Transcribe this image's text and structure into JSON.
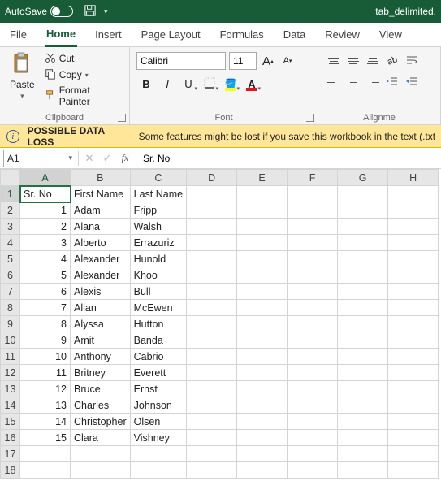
{
  "titlebar": {
    "autosave_label": "AutoSave",
    "autosave_off": "Off",
    "filename": "tab_delimited."
  },
  "tabs": {
    "file": "File",
    "home": "Home",
    "insert": "Insert",
    "page_layout": "Page Layout",
    "formulas": "Formulas",
    "data": "Data",
    "review": "Review",
    "view": "View"
  },
  "ribbon": {
    "clipboard": {
      "label": "Clipboard",
      "paste": "Paste",
      "cut": "Cut",
      "copy": "Copy",
      "format_painter": "Format Painter"
    },
    "font": {
      "label": "Font",
      "name": "Calibri",
      "size": "11",
      "bold": "B",
      "italic": "I",
      "underline": "U",
      "fill_letter": "A",
      "fontcolor_letter": "A",
      "grow": "A",
      "shrink": "A"
    },
    "alignment": {
      "label": "Alignme"
    }
  },
  "msgbar": {
    "title": "POSSIBLE DATA LOSS",
    "text": "Some features might be lost if you save this workbook in the text (.txt) f"
  },
  "fbar": {
    "namebox": "A1",
    "fx": "fx",
    "value": "Sr. No"
  },
  "cols": [
    "A",
    "B",
    "C",
    "D",
    "E",
    "F",
    "G",
    "H"
  ],
  "active": {
    "col": 0,
    "row": 0
  },
  "rows_shown": 18,
  "cells": [
    [
      "Sr. No",
      "First Name",
      "Last Name",
      "",
      "",
      "",
      "",
      ""
    ],
    [
      "1",
      "Adam",
      "Fripp",
      "",
      "",
      "",
      "",
      ""
    ],
    [
      "2",
      "Alana",
      "Walsh",
      "",
      "",
      "",
      "",
      ""
    ],
    [
      "3",
      "Alberto",
      "Errazuriz",
      "",
      "",
      "",
      "",
      ""
    ],
    [
      "4",
      "Alexander",
      "Hunold",
      "",
      "",
      "",
      "",
      ""
    ],
    [
      "5",
      "Alexander",
      "Khoo",
      "",
      "",
      "",
      "",
      ""
    ],
    [
      "6",
      "Alexis",
      "Bull",
      "",
      "",
      "",
      "",
      ""
    ],
    [
      "7",
      "Allan",
      "McEwen",
      "",
      "",
      "",
      "",
      ""
    ],
    [
      "8",
      "Alyssa",
      "Hutton",
      "",
      "",
      "",
      "",
      ""
    ],
    [
      "9",
      "Amit",
      "Banda",
      "",
      "",
      "",
      "",
      ""
    ],
    [
      "10",
      "Anthony",
      "Cabrio",
      "",
      "",
      "",
      "",
      ""
    ],
    [
      "11",
      "Britney",
      "Everett",
      "",
      "",
      "",
      "",
      ""
    ],
    [
      "12",
      "Bruce",
      "Ernst",
      "",
      "",
      "",
      "",
      ""
    ],
    [
      "13",
      "Charles",
      "Johnson",
      "",
      "",
      "",
      "",
      ""
    ],
    [
      "14",
      "Christopher",
      "Olsen",
      "",
      "",
      "",
      "",
      ""
    ],
    [
      "15",
      "Clara",
      "Vishney",
      "",
      "",
      "",
      "",
      ""
    ],
    [
      "",
      "",
      "",
      "",
      "",
      "",
      "",
      ""
    ],
    [
      "",
      "",
      "",
      "",
      "",
      "",
      "",
      ""
    ]
  ],
  "numeric_cols": [
    0
  ]
}
